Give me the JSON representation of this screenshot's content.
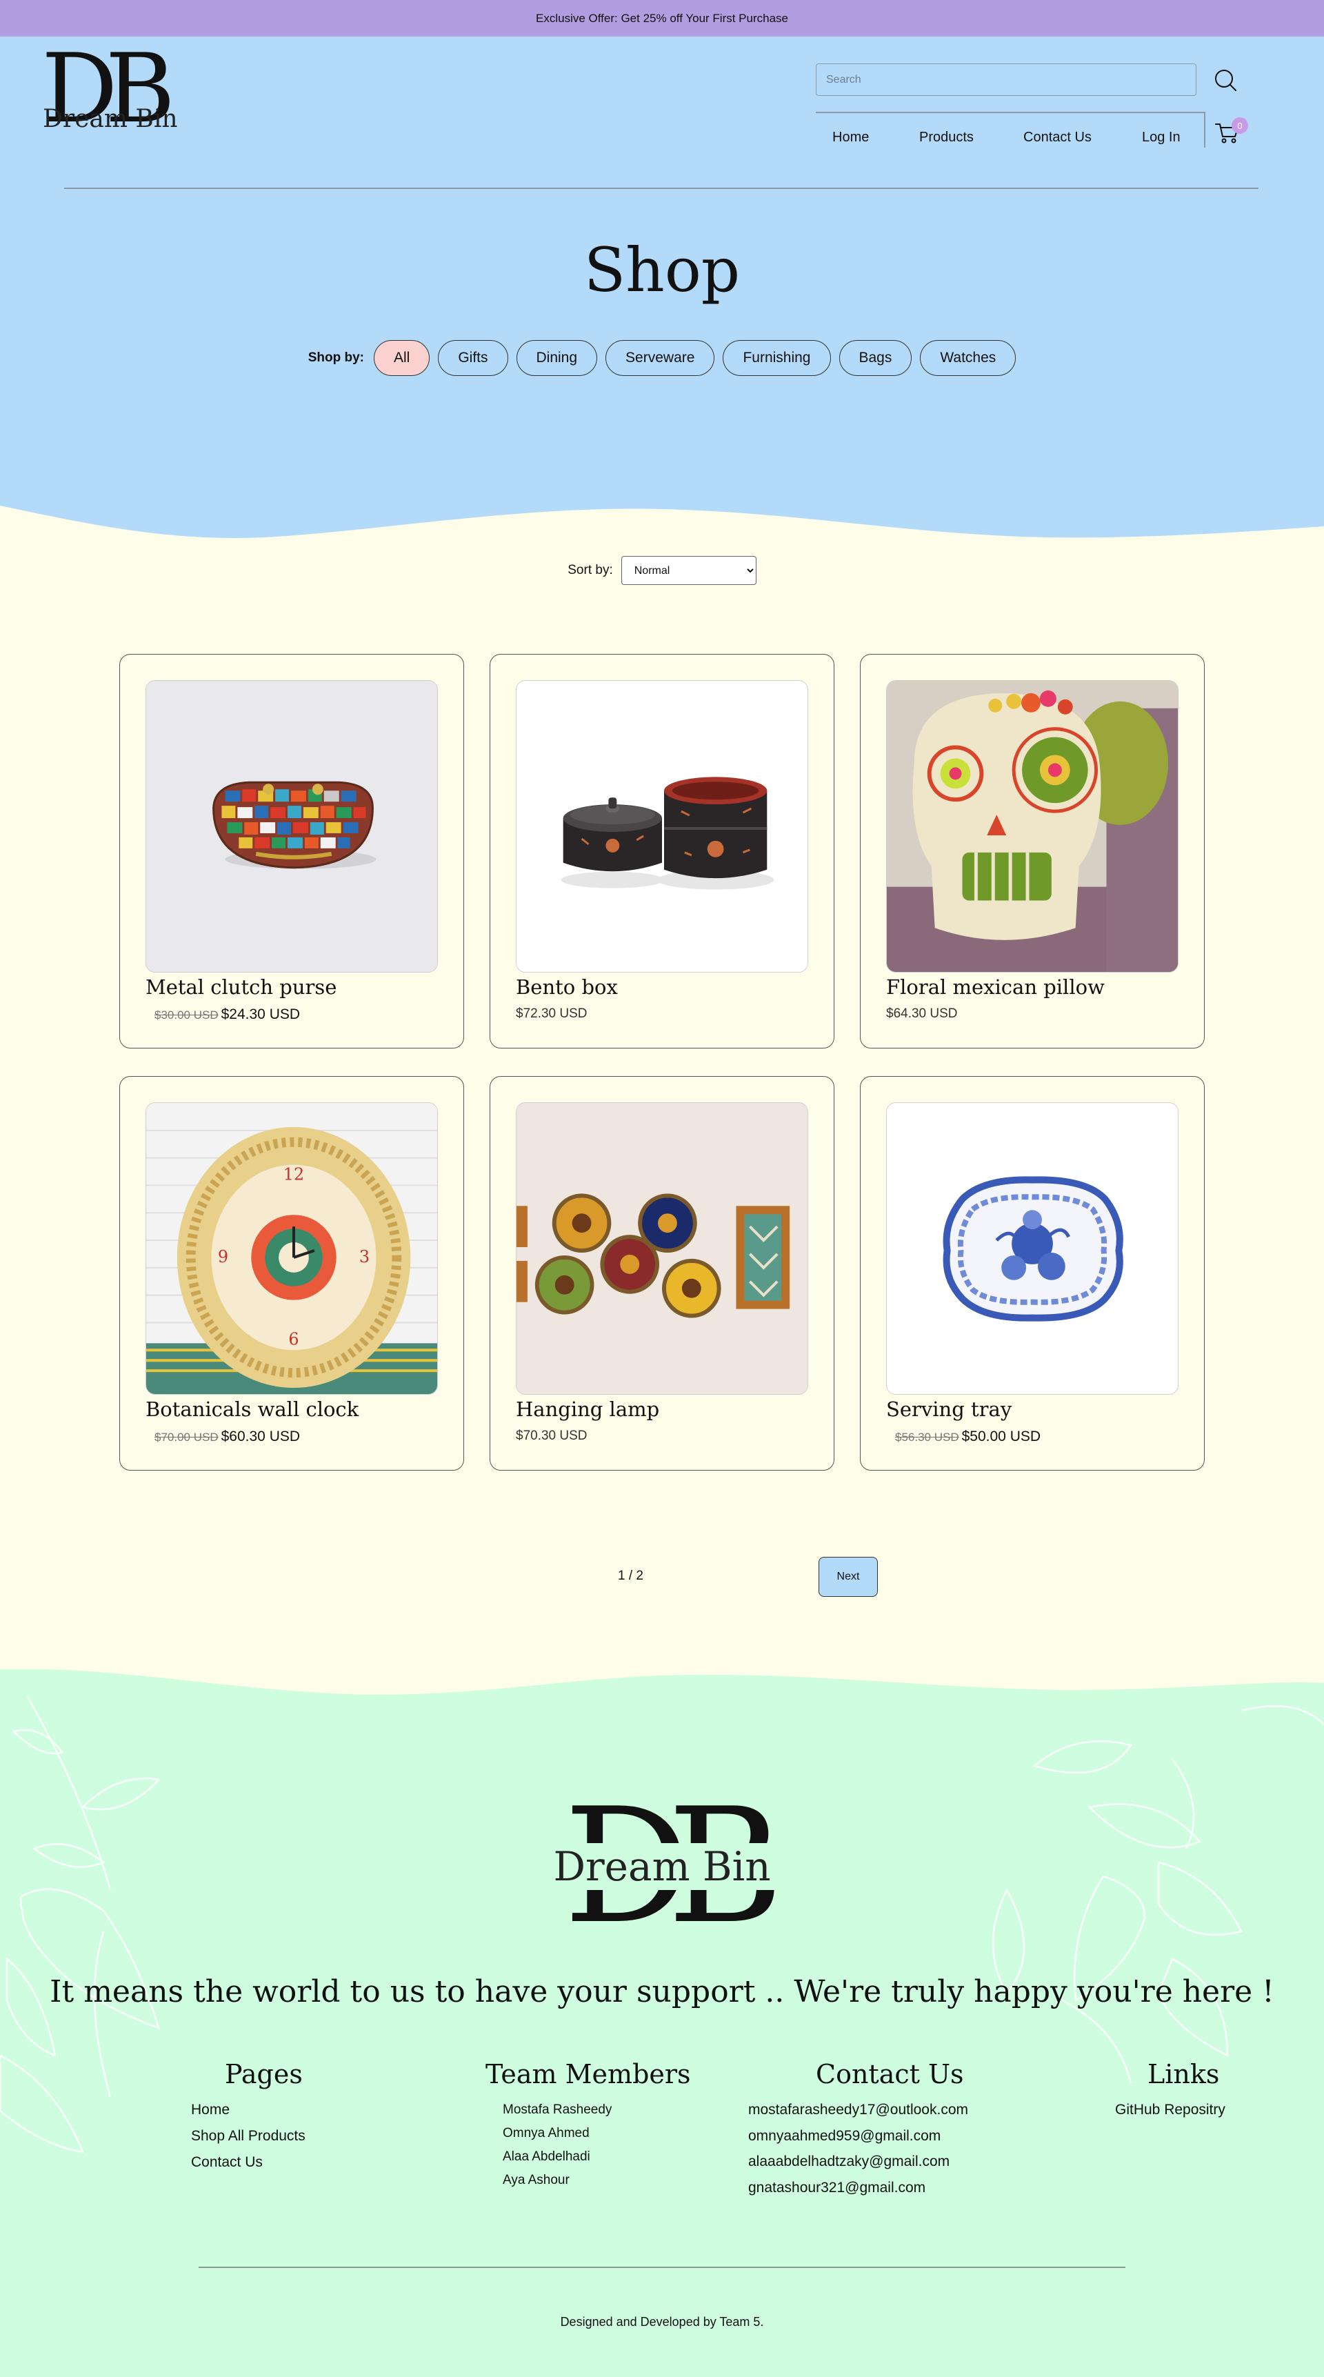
{
  "announcement": "Exclusive Offer: Get 25% off Your First Purchase",
  "brand": {
    "letters": "DB",
    "name": "Dream Bin"
  },
  "search": {
    "placeholder": "Search",
    "value": ""
  },
  "nav": [
    "Home",
    "Products",
    "Contact Us",
    "Log In"
  ],
  "cart": {
    "count": "0"
  },
  "shop": {
    "title": "Shop",
    "shop_by_label": "Shop by:",
    "categories": [
      "All",
      "Gifts",
      "Dining",
      "Serveware",
      "Furnishing",
      "Bags",
      "Watches"
    ],
    "active_category": "All"
  },
  "sort": {
    "label": "Sort by:",
    "selected": "Normal"
  },
  "products": [
    {
      "name": "Metal clutch purse",
      "old_price": "$30.00 USD",
      "price": "$24.30 USD",
      "image": "mosaic-clutch-purse"
    },
    {
      "name": "Bento box",
      "old_price": "",
      "price": "$72.30 USD",
      "image": "black-lacquer-bento-box"
    },
    {
      "name": "Floral mexican pillow",
      "old_price": "",
      "price": "$64.30 USD",
      "image": "sugar-skull-pillow"
    },
    {
      "name": "Botanicals wall clock",
      "old_price": "$70.00 USD",
      "price": "$60.30 USD",
      "image": "woven-wall-clock"
    },
    {
      "name": "Hanging lamp",
      "old_price": "",
      "price": "$70.30 USD",
      "image": "decorative-wall-plates"
    },
    {
      "name": "Serving tray",
      "old_price": "$56.30 USD",
      "price": "$50.00 USD",
      "image": "blue-willow-tray"
    }
  ],
  "pagination": {
    "status": "1 / 2",
    "next_label": "Next"
  },
  "footer": {
    "tagline": "It means the world to us to have your support .. We're truly happy you're here !",
    "pages": {
      "title": "Pages",
      "items": [
        "Home",
        "Shop All Products",
        "Contact Us"
      ]
    },
    "team": {
      "title": "Team Members",
      "items": [
        "Mostafa Rasheedy",
        "Omnya Ahmed",
        "Alaa Abdelhadi",
        "Aya Ashour"
      ]
    },
    "contact": {
      "title": "Contact Us",
      "items": [
        "mostafarasheedy17@outlook.com",
        "omnyaahmed959@gmail.com",
        "alaaabdelhadtzaky@gmail.com",
        "gnatashour321@gmail.com"
      ]
    },
    "links": {
      "title": "Links",
      "items": [
        "GitHub Repositry"
      ]
    },
    "credits": "Designed and Developed by Team 5."
  },
  "colors": {
    "announce": "#b19ee0",
    "hero": "#b3daf8",
    "body": "#fefde9",
    "footer": "#cefde0",
    "active_chip": "#fcd2d0",
    "badge": "#c79be8"
  }
}
